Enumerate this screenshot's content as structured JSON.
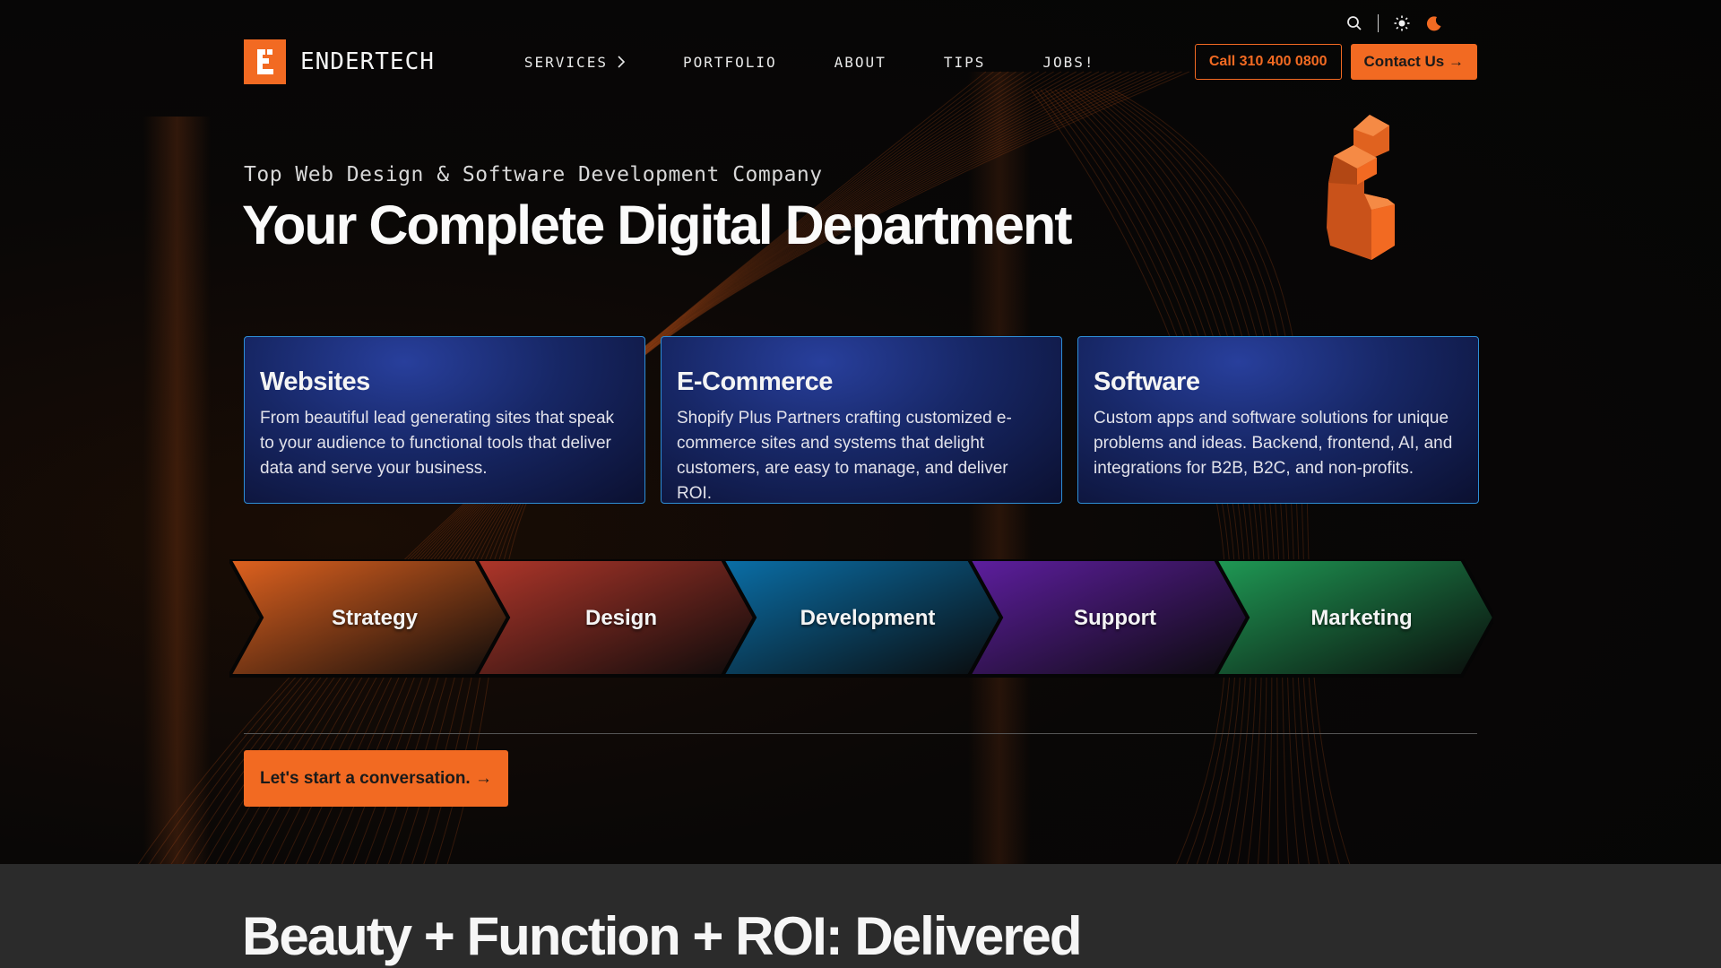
{
  "utility": {
    "icons": [
      "search-icon",
      "sun-icon",
      "moon-icon"
    ]
  },
  "brand": {
    "name": "ENDERTECH",
    "accent": "#f26a22"
  },
  "nav": {
    "items": [
      {
        "label": "SERVICES",
        "has_chevron": true
      },
      {
        "label": "PORTFOLIO"
      },
      {
        "label": "ABOUT"
      },
      {
        "label": "TIPS"
      },
      {
        "label": "JOBS!"
      }
    ]
  },
  "header_actions": {
    "call_label": "Call 310 400 0800",
    "contact_label": "Contact Us →"
  },
  "hero": {
    "eyebrow": "Top Web Design & Software Development Company",
    "title": "Your Complete Digital Department"
  },
  "cards": [
    {
      "title": "Websites",
      "text": "From beautiful lead generating sites that speak to your audience to functional tools that deliver data and serve your business."
    },
    {
      "title": "E-Commerce",
      "text": "Shopify Plus Partners crafting customized e-commerce sites and systems that delight customers, are easy to manage, and deliver ROI."
    },
    {
      "title": "Software",
      "text": "Custom apps and software solutions for unique problems and ideas. Backend, frontend, AI, and integrations for B2B, B2C, and non-profits."
    }
  ],
  "process": [
    {
      "label": "Strategy",
      "color": "#e0621f"
    },
    {
      "label": "Design",
      "color": "#b0362a"
    },
    {
      "label": "Development",
      "color": "#0a6fa8"
    },
    {
      "label": "Support",
      "color": "#5e1ea0"
    },
    {
      "label": "Marketing",
      "color": "#1f9a55"
    }
  ],
  "cta": {
    "label": "Let's start a conversation. →"
  },
  "section2": {
    "title": "Beauty + Function + ROI: Delivered"
  }
}
